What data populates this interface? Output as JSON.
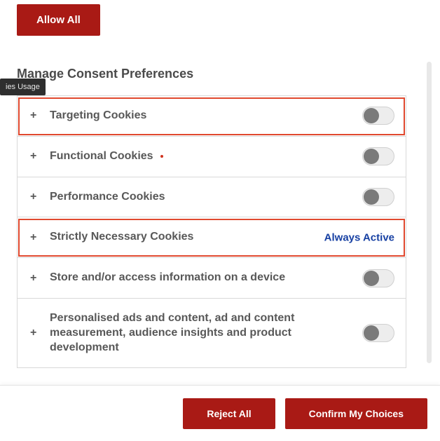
{
  "buttons": {
    "allow_all": "Allow All",
    "reject_all": "Reject All",
    "confirm": "Confirm My Choices"
  },
  "heading": "Manage Consent Preferences",
  "side_badge": "ies Usage",
  "always_active_text": "Always Active",
  "categories": [
    {
      "id": "targeting",
      "label": "Targeting Cookies",
      "toggle": true,
      "on": false,
      "highlight": true,
      "has_dot": false
    },
    {
      "id": "functional",
      "label": "Functional Cookies",
      "toggle": true,
      "on": false,
      "highlight": false,
      "has_dot": true
    },
    {
      "id": "performance",
      "label": "Performance Cookies",
      "toggle": true,
      "on": false,
      "highlight": false,
      "has_dot": false
    },
    {
      "id": "strictly-necessary",
      "label": "Strictly Necessary Cookies",
      "toggle": false,
      "always_active": true,
      "highlight": true,
      "has_dot": false
    },
    {
      "id": "store-access",
      "label": "Store and/or access information on a device",
      "toggle": true,
      "on": false,
      "highlight": false,
      "has_dot": false
    },
    {
      "id": "personalised",
      "label": "Personalised ads and content, ad and content measurement, audience insights and product development",
      "toggle": true,
      "on": false,
      "highlight": false,
      "has_dot": false
    }
  ]
}
